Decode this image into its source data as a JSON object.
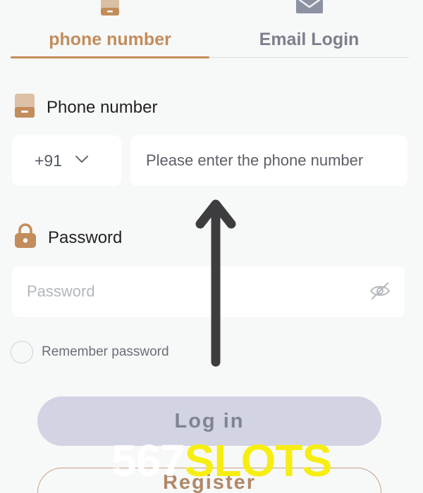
{
  "tabs": {
    "phone": {
      "label": "phone number",
      "icon": "phone-icon",
      "active": true
    },
    "email": {
      "label": "Email Login",
      "icon": "mail-icon",
      "active": false
    }
  },
  "phone_section": {
    "title": "Phone number",
    "icon": "phone-icon",
    "country_code": "+91",
    "phone_placeholder": "Please enter the phone number",
    "phone_value": ""
  },
  "password_section": {
    "title": "Password",
    "icon": "lock-icon",
    "placeholder": "Password",
    "value": "",
    "toggle_icon": "eye-off-icon"
  },
  "remember": {
    "label": "Remember password",
    "checked": false
  },
  "buttons": {
    "login": "Log in",
    "register": "Register"
  },
  "watermark": {
    "number": "567",
    "word": "SLOTS"
  },
  "colors": {
    "accent": "#c38c5b",
    "background": "#f7f8f8",
    "login_button_bg": "#d2d3e3",
    "watermark_yellow": "#f6ee12"
  }
}
